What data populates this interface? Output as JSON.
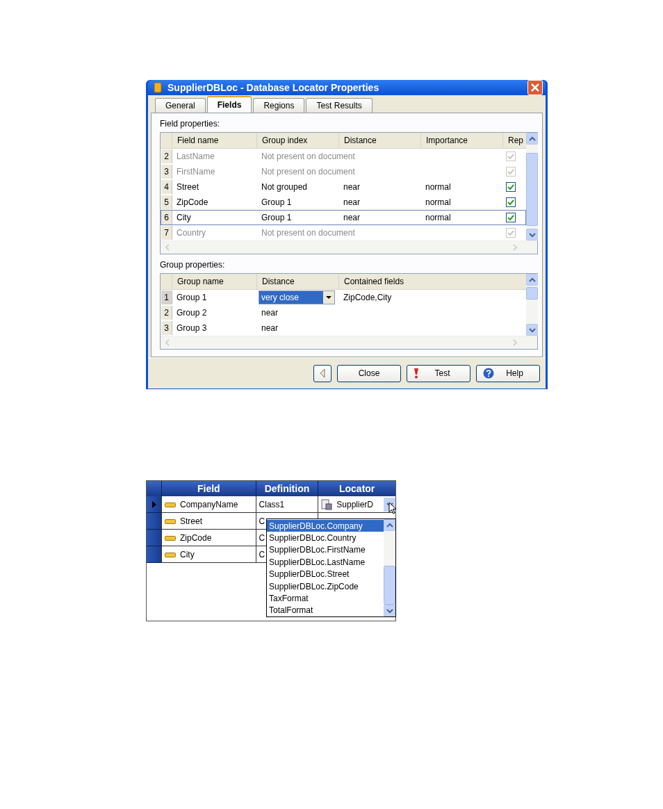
{
  "dialog": {
    "title": "SupplierDBLoc - Database Locator Properties",
    "tabs": [
      {
        "label": "General",
        "selected": false
      },
      {
        "label": "Fields",
        "selected": true
      },
      {
        "label": "Regions",
        "selected": false
      },
      {
        "label": "Test Results",
        "selected": false
      }
    ],
    "field_properties": {
      "label": "Field properties:",
      "columns": [
        "Field name",
        "Group index",
        "Distance",
        "Importance",
        "Rep"
      ],
      "rows": [
        {
          "index": "2",
          "field_name": "LastName",
          "group_index": "Not present on document",
          "distance": "",
          "importance": "",
          "enabled": false,
          "checked": true,
          "selected": false
        },
        {
          "index": "3",
          "field_name": "FirstName",
          "group_index": "Not present on document",
          "distance": "",
          "importance": "",
          "enabled": false,
          "checked": true,
          "selected": false
        },
        {
          "index": "4",
          "field_name": "Street",
          "group_index": "Not grouped",
          "distance": "near",
          "importance": "normal",
          "enabled": true,
          "checked": true,
          "selected": false
        },
        {
          "index": "5",
          "field_name": "ZipCode",
          "group_index": "Group 1",
          "distance": "near",
          "importance": "normal",
          "enabled": true,
          "checked": true,
          "selected": false
        },
        {
          "index": "6",
          "field_name": "City",
          "group_index": "Group 1",
          "distance": "near",
          "importance": "normal",
          "enabled": true,
          "checked": true,
          "selected": true
        },
        {
          "index": "7",
          "field_name": "Country",
          "group_index": "Not present on document",
          "distance": "",
          "importance": "",
          "enabled": false,
          "checked": true,
          "selected": false
        }
      ]
    },
    "group_properties": {
      "label": "Group properties:",
      "columns": [
        "Group name",
        "Distance",
        "Contained fields"
      ],
      "rows": [
        {
          "index": "1",
          "group_name": "Group 1",
          "distance": "very close",
          "contained_fields": "ZipCode,City",
          "editing": true
        },
        {
          "index": "2",
          "group_name": "Group 2",
          "distance": "near",
          "contained_fields": "",
          "editing": false
        },
        {
          "index": "3",
          "group_name": "Group 3",
          "distance": "near",
          "contained_fields": "",
          "editing": false
        }
      ]
    },
    "buttons": [
      {
        "kind": "back"
      },
      {
        "kind": "plain",
        "label": "Close"
      },
      {
        "kind": "test",
        "label": "Test"
      },
      {
        "kind": "help",
        "label": "Help"
      }
    ]
  },
  "mapping_grid": {
    "columns": [
      "Field",
      "Definition",
      "Locator"
    ],
    "rows": [
      {
        "field": "CompanyName",
        "definition": "Class1",
        "locator": "SupplierD",
        "selected": true
      },
      {
        "field": "Street",
        "definition": "C",
        "locator": "",
        "selected": false
      },
      {
        "field": "ZipCode",
        "definition": "C",
        "locator": "",
        "selected": false
      },
      {
        "field": "City",
        "definition": "C",
        "locator": "",
        "selected": false
      }
    ],
    "dropdown": {
      "items": [
        {
          "label": "SupplierDBLoc.Company",
          "selected": true
        },
        {
          "label": "SupplierDBLoc.Country",
          "selected": false
        },
        {
          "label": "SupplierDBLoc.FirstName",
          "selected": false
        },
        {
          "label": "SupplierDBLoc.LastName",
          "selected": false
        },
        {
          "label": "SupplierDBLoc.Street",
          "selected": false
        },
        {
          "label": "SupplierDBLoc.ZipCode",
          "selected": false
        },
        {
          "label": "TaxFormat",
          "selected": false
        },
        {
          "label": "TotalFormat",
          "selected": false
        }
      ]
    }
  }
}
